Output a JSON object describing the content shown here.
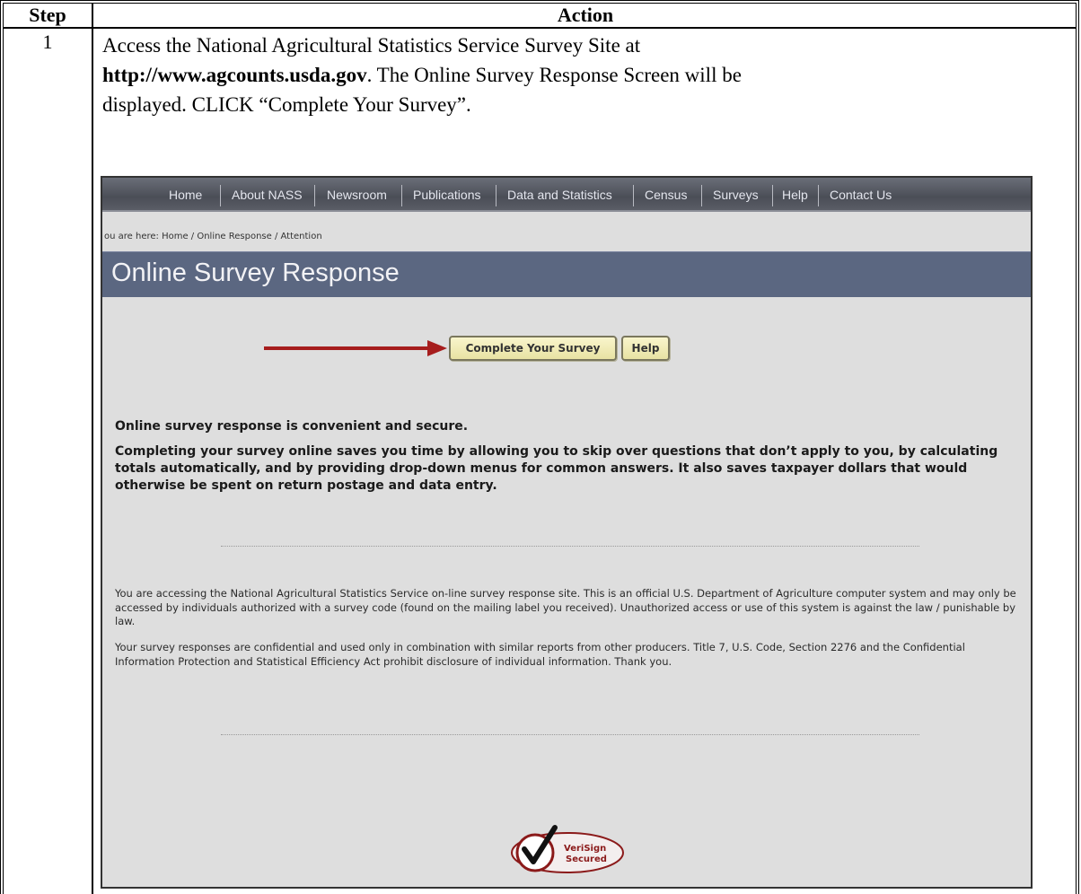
{
  "table": {
    "header_step": "Step",
    "header_action": "Action"
  },
  "step": {
    "number": "1",
    "line1": "Access the National Agricultural Statistics Service Survey Site at",
    "url": "http://www.agcounts.usda.gov",
    "line2_after_url": ".  The Online Survey Response Screen will be",
    "line3": "displayed.  CLICK “Complete Your Survey”."
  },
  "screenshot": {
    "nav": {
      "items": [
        "Home",
        "About NASS",
        "Newsroom",
        "Publications",
        "Data and Statistics",
        "Census",
        "Surveys",
        "Help",
        "Contact Us"
      ]
    },
    "breadcrumb": "ou are here:  Home / Online Response / Attention",
    "banner_title": "Online Survey Response",
    "buttons": {
      "complete": "Complete Your Survey",
      "help": "Help"
    },
    "heading": "Online survey response is convenient and secure.",
    "benefits_paragraph": "Completing your survey online saves you time by allowing you to skip over questions that don’t apply to you, by calculating totals automatically, and by providing drop-down menus for common answers. It also saves taxpayer dollars that would otherwise be spent on return postage and data entry.",
    "access_paragraph": "You are accessing the National Agricultural Statistics Service on-line survey response site. This is an official U.S. Department of Agriculture computer system and may only be accessed by individuals authorized with a survey code (found on the mailing label you received). Unauthorized access or use of this system is against the law / punishable by law.",
    "confidential_paragraph": "Your survey responses are confidential and used only in combination with similar reports from other producers. Title 7, U.S. Code, Section 2276 and the Confidential Information Protection and Statistical Efficiency Act prohibit disclosure of individual information. Thank you.",
    "seal": {
      "line1": "VeriSign",
      "line2": "Secured"
    },
    "colors": {
      "banner": "#5b6781",
      "navbar": "#4b4e57",
      "arrow": "#a61d1d",
      "button": "#efe9b4"
    }
  }
}
